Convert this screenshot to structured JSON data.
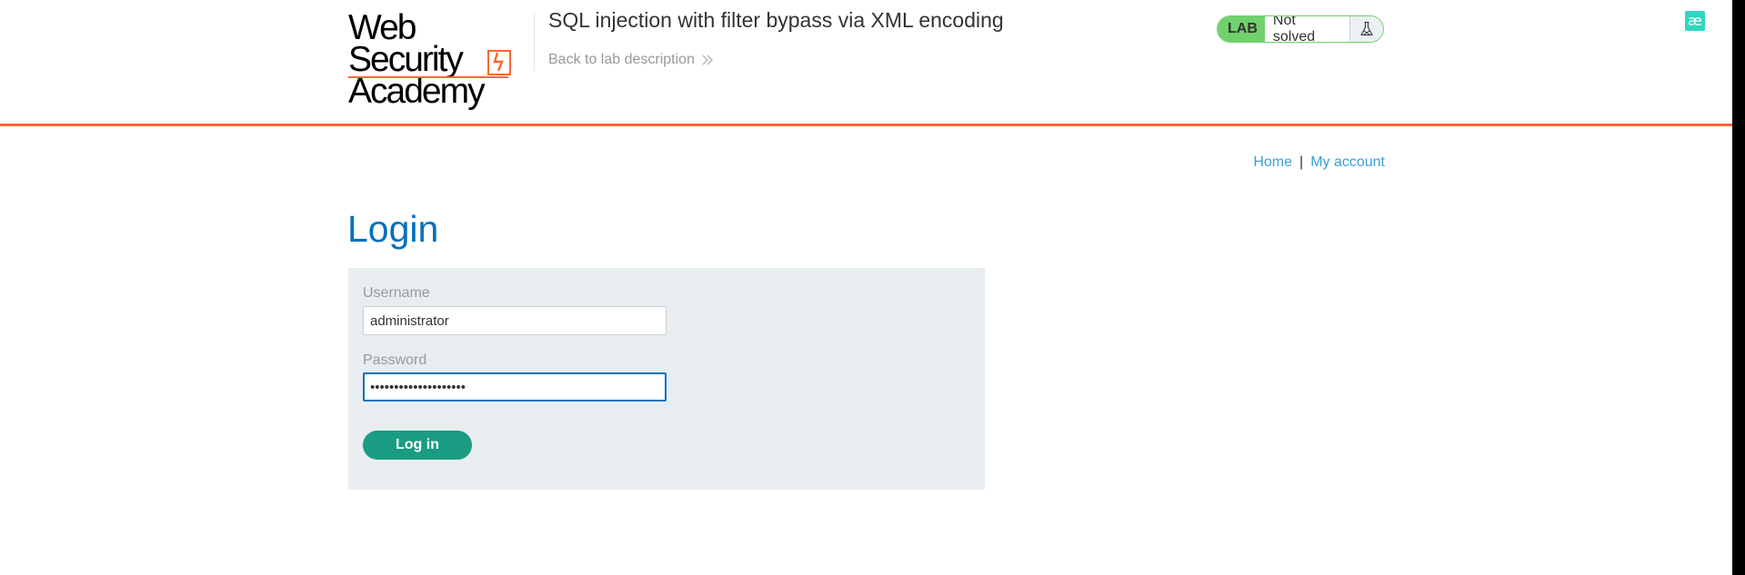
{
  "extension": {
    "icon": "ae-ligature-icon",
    "glyph": "æ",
    "color": "#30d6c0"
  },
  "header": {
    "logo": {
      "line1": "Web Security",
      "line2": "Academy",
      "icon": "lightning-bolt-icon",
      "accent": "#ff6633"
    },
    "lab_title": "SQL injection with filter bypass via XML encoding",
    "back_link": "Back to lab description",
    "status": {
      "badge": "LAB",
      "text": "Not solved",
      "icon": "flask-icon",
      "color": "#70d16d"
    }
  },
  "nav": {
    "home": "Home",
    "separator": "|",
    "account": "My account"
  },
  "main": {
    "title": "Login",
    "username_label": "Username",
    "username_value": "administrator",
    "password_label": "Password",
    "password_value": "••••••••••••••••••••",
    "submit_label": "Log in"
  },
  "colors": {
    "title_blue": "#0071bc",
    "link_blue": "#3a9fd6",
    "button_green": "#1a9c83",
    "panel_bg": "#e8edf0"
  }
}
